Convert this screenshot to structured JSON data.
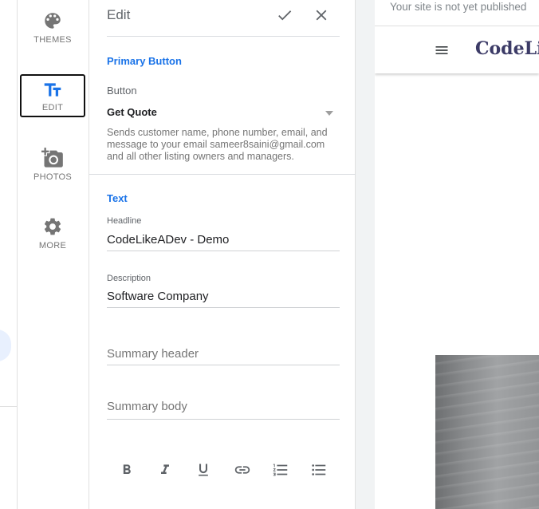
{
  "rail": {
    "items": [
      {
        "label": "THEMES",
        "icon": "palette-icon"
      },
      {
        "label": "EDIT",
        "icon": "text-format-icon"
      },
      {
        "label": "PHOTOS",
        "icon": "add-photo-icon"
      },
      {
        "label": "MORE",
        "icon": "gear-icon"
      }
    ],
    "active_color": "#1a73e8",
    "icon_color": "#757575"
  },
  "editor": {
    "title": "Edit",
    "primary_button": {
      "section_title": "Primary Button",
      "field_label": "Button",
      "selected_value": "Get Quote",
      "help_text": "Sends customer name, phone number, email, and message to your email sameer8saini@gmail.com and all other listing owners and managers."
    },
    "text": {
      "section_title": "Text",
      "headline_label": "Headline",
      "headline_value": "CodeLikeADev - Demo",
      "description_label": "Description",
      "description_value": "Software Company",
      "summary_header_placeholder": "Summary header",
      "summary_body_placeholder": "Summary body"
    },
    "toolbar": [
      "bold-icon",
      "italic-icon",
      "underline-icon",
      "link-icon",
      "numbered-list-icon",
      "bulleted-list-icon"
    ],
    "accent_color": "#1a73e8"
  },
  "preview": {
    "status": "Your site is not yet published",
    "brand": "CodeLi",
    "brand_color": "#3c3b67"
  }
}
